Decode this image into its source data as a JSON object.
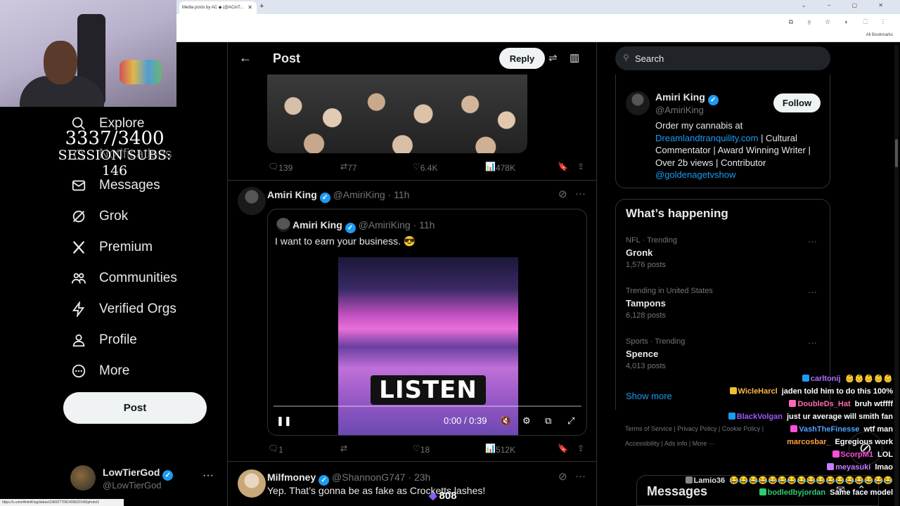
{
  "browser": {
    "tab_title": "Media posts by AC ◆ (@ACinT...",
    "tab_close": "✕",
    "new_tab": "+",
    "bookmarks_label": "All Bookmarks",
    "status_url": "https://x.com/AmiriKing/status/1960277091405620149/photo/1"
  },
  "stream_overlay": {
    "sub_count": "3337/3400",
    "session_subs": "SESSION SUBS: 146",
    "bits": "808"
  },
  "sidebar": {
    "items": [
      {
        "label": "Explore",
        "icon": "search-icon"
      },
      {
        "label": "Notifications",
        "icon": "bell-icon"
      },
      {
        "label": "Messages",
        "icon": "envelope-icon"
      },
      {
        "label": "Grok",
        "icon": "grok-icon"
      },
      {
        "label": "Premium",
        "icon": "x-logo-icon"
      },
      {
        "label": "Communities",
        "icon": "people-icon"
      },
      {
        "label": "Verified Orgs",
        "icon": "lightning-icon"
      },
      {
        "label": "Profile",
        "icon": "person-icon"
      },
      {
        "label": "More",
        "icon": "more-circle-icon"
      }
    ],
    "post_button": "Post",
    "account": {
      "name": "LowTierGod",
      "handle": "@LowTierGod",
      "more": "···"
    }
  },
  "header": {
    "title": "Post",
    "reply_label": "Reply"
  },
  "post1_actions": {
    "replies": "139",
    "reposts": "77",
    "likes": "6.4K",
    "views": "478K"
  },
  "tweet2": {
    "name": "Amiri King",
    "handle": "@AmiriKing",
    "time": "· 11h",
    "quote": {
      "name": "Amiri King",
      "handle": "@AmiriKing",
      "time": "· 11h",
      "text": "I want to earn your business. 😎",
      "video_text": "LISTEN",
      "video_time": "0:00 / 0:39"
    },
    "actions": {
      "replies": "1",
      "reposts": "",
      "likes": "18",
      "views": "512K"
    }
  },
  "tweet3": {
    "name": "Milfmoney",
    "handle": "@ShannonG747",
    "time": "· 23h",
    "text": "Yep. That’s gonna be as fake as Crocketts lashes!"
  },
  "right": {
    "search_placeholder": "Search",
    "profile": {
      "name": "Amiri King",
      "handle": "@AmiriKing",
      "follow": "Follow",
      "bio_pre": "Order my cannabis at",
      "bio_link": "Dreamlandtranquility.com",
      "bio_mid": "| Cultural Commentator | Award Winning Writer | Over 2b views | Contributor",
      "bio_mention": "@goldenagetvshow"
    },
    "happening": {
      "title": "What’s happening",
      "trends": [
        {
          "meta": "NFL · Trending",
          "name": "Gronk",
          "count": "1,576 posts"
        },
        {
          "meta": "Trending in United States",
          "name": "Tampons",
          "count": "6,128 posts"
        },
        {
          "meta": "Sports · Trending",
          "name": "Spence",
          "count": "4,013 posts"
        }
      ],
      "show_more": "Show more"
    },
    "footer": {
      "line1": "Terms of Service  |  Privacy Policy  |  Cookie Policy  |",
      "line2": "Accessibility  |  Ads info  |  More ···"
    },
    "messages_title": "Messages"
  },
  "chat": [
    {
      "user": "carltonij",
      "color": "#a970ff",
      "msg": "👶👶👶👶👶"
    },
    {
      "user": "WicleHarcl",
      "color": "#ffb347",
      "msg": "jaden told him to do this 100%"
    },
    {
      "user": "DoubleDs_Hat",
      "color": "#ff69b4",
      "msg": "bruh wtffff"
    },
    {
      "user": "BlackVolgan",
      "color": "#9b59ff",
      "msg": "just ur average will smith fan"
    },
    {
      "user": "VashTheFinesse",
      "color": "#4fa3ff",
      "msg": "wtf man"
    },
    {
      "user": "marcosbar_",
      "color": "#ff9f43",
      "msg": "Egregious work"
    },
    {
      "user": "ScorpM1",
      "color": "#ff4fd8",
      "msg": "LOL"
    },
    {
      "user": "meyasuki",
      "color": "#c77dff",
      "msg": "lmao"
    },
    {
      "user": "Lamio36",
      "color": "#e0e0e0",
      "msg": "😂😂😂😂😂😂😂😂😂😂😂😂😂😂😂😂😂"
    },
    {
      "user": "bodledbyjordan",
      "color": "#2ecc71",
      "msg": "Same face model"
    }
  ],
  "colors": {
    "accent": "#1d9bf0",
    "bg": "#000000",
    "border": "#2f3336",
    "muted": "#71767b"
  }
}
